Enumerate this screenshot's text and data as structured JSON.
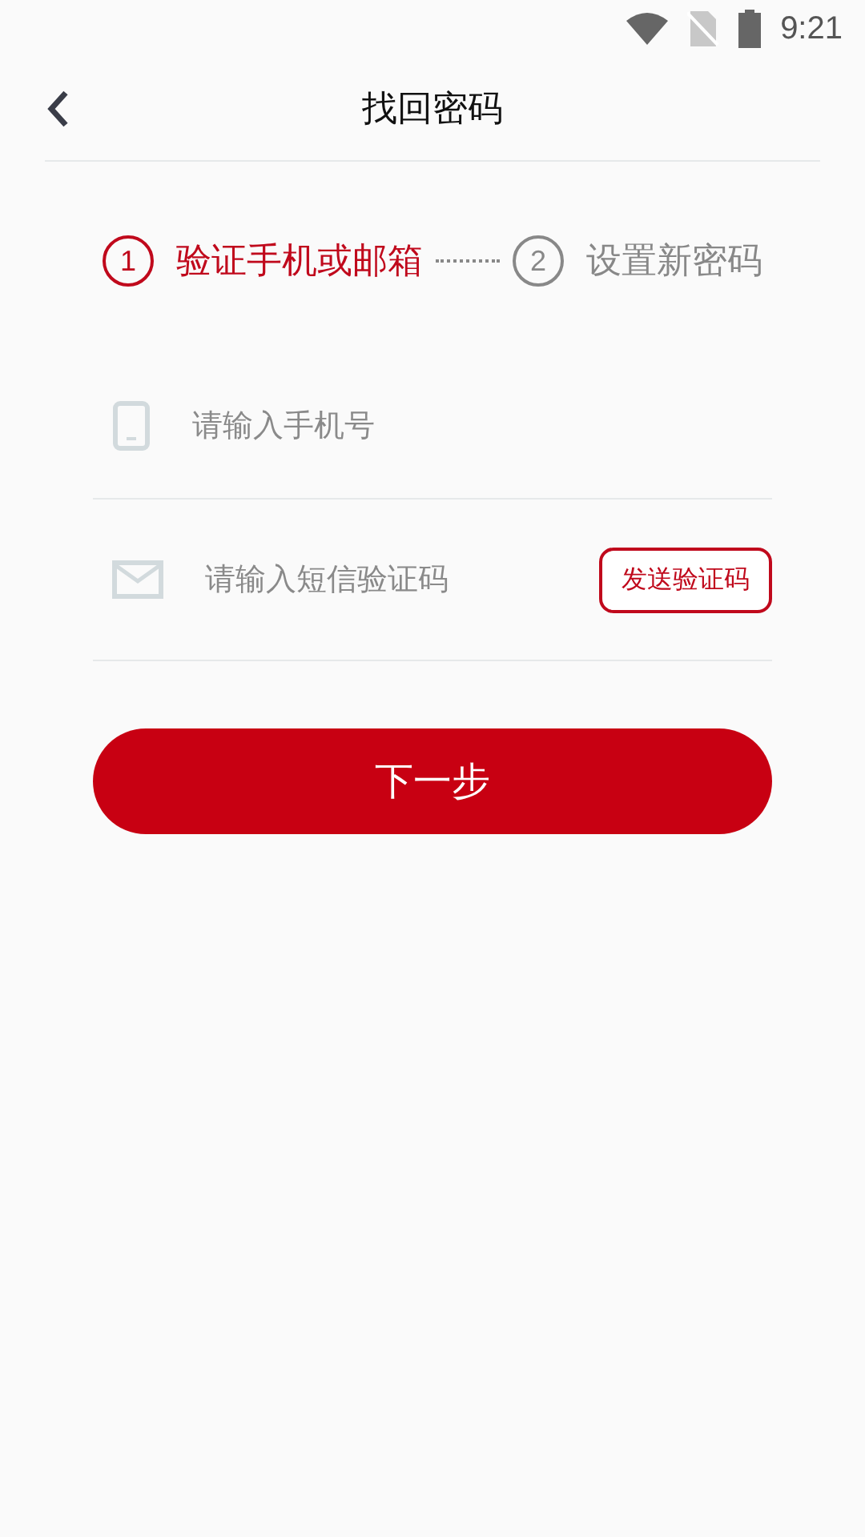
{
  "status_bar": {
    "time": "9:21"
  },
  "header": {
    "title": "找回密码"
  },
  "steps": [
    {
      "number": "1",
      "label": "验证手机或邮箱",
      "selected": true
    },
    {
      "number": "2",
      "label": "设置新密码",
      "selected": false
    }
  ],
  "fields": [
    {
      "kind": "phone",
      "placeholder": "请输入手机号"
    },
    {
      "kind": "code",
      "placeholder": "请输入短信验证码",
      "button": "发送验证码"
    }
  ],
  "submit": "下一步"
}
